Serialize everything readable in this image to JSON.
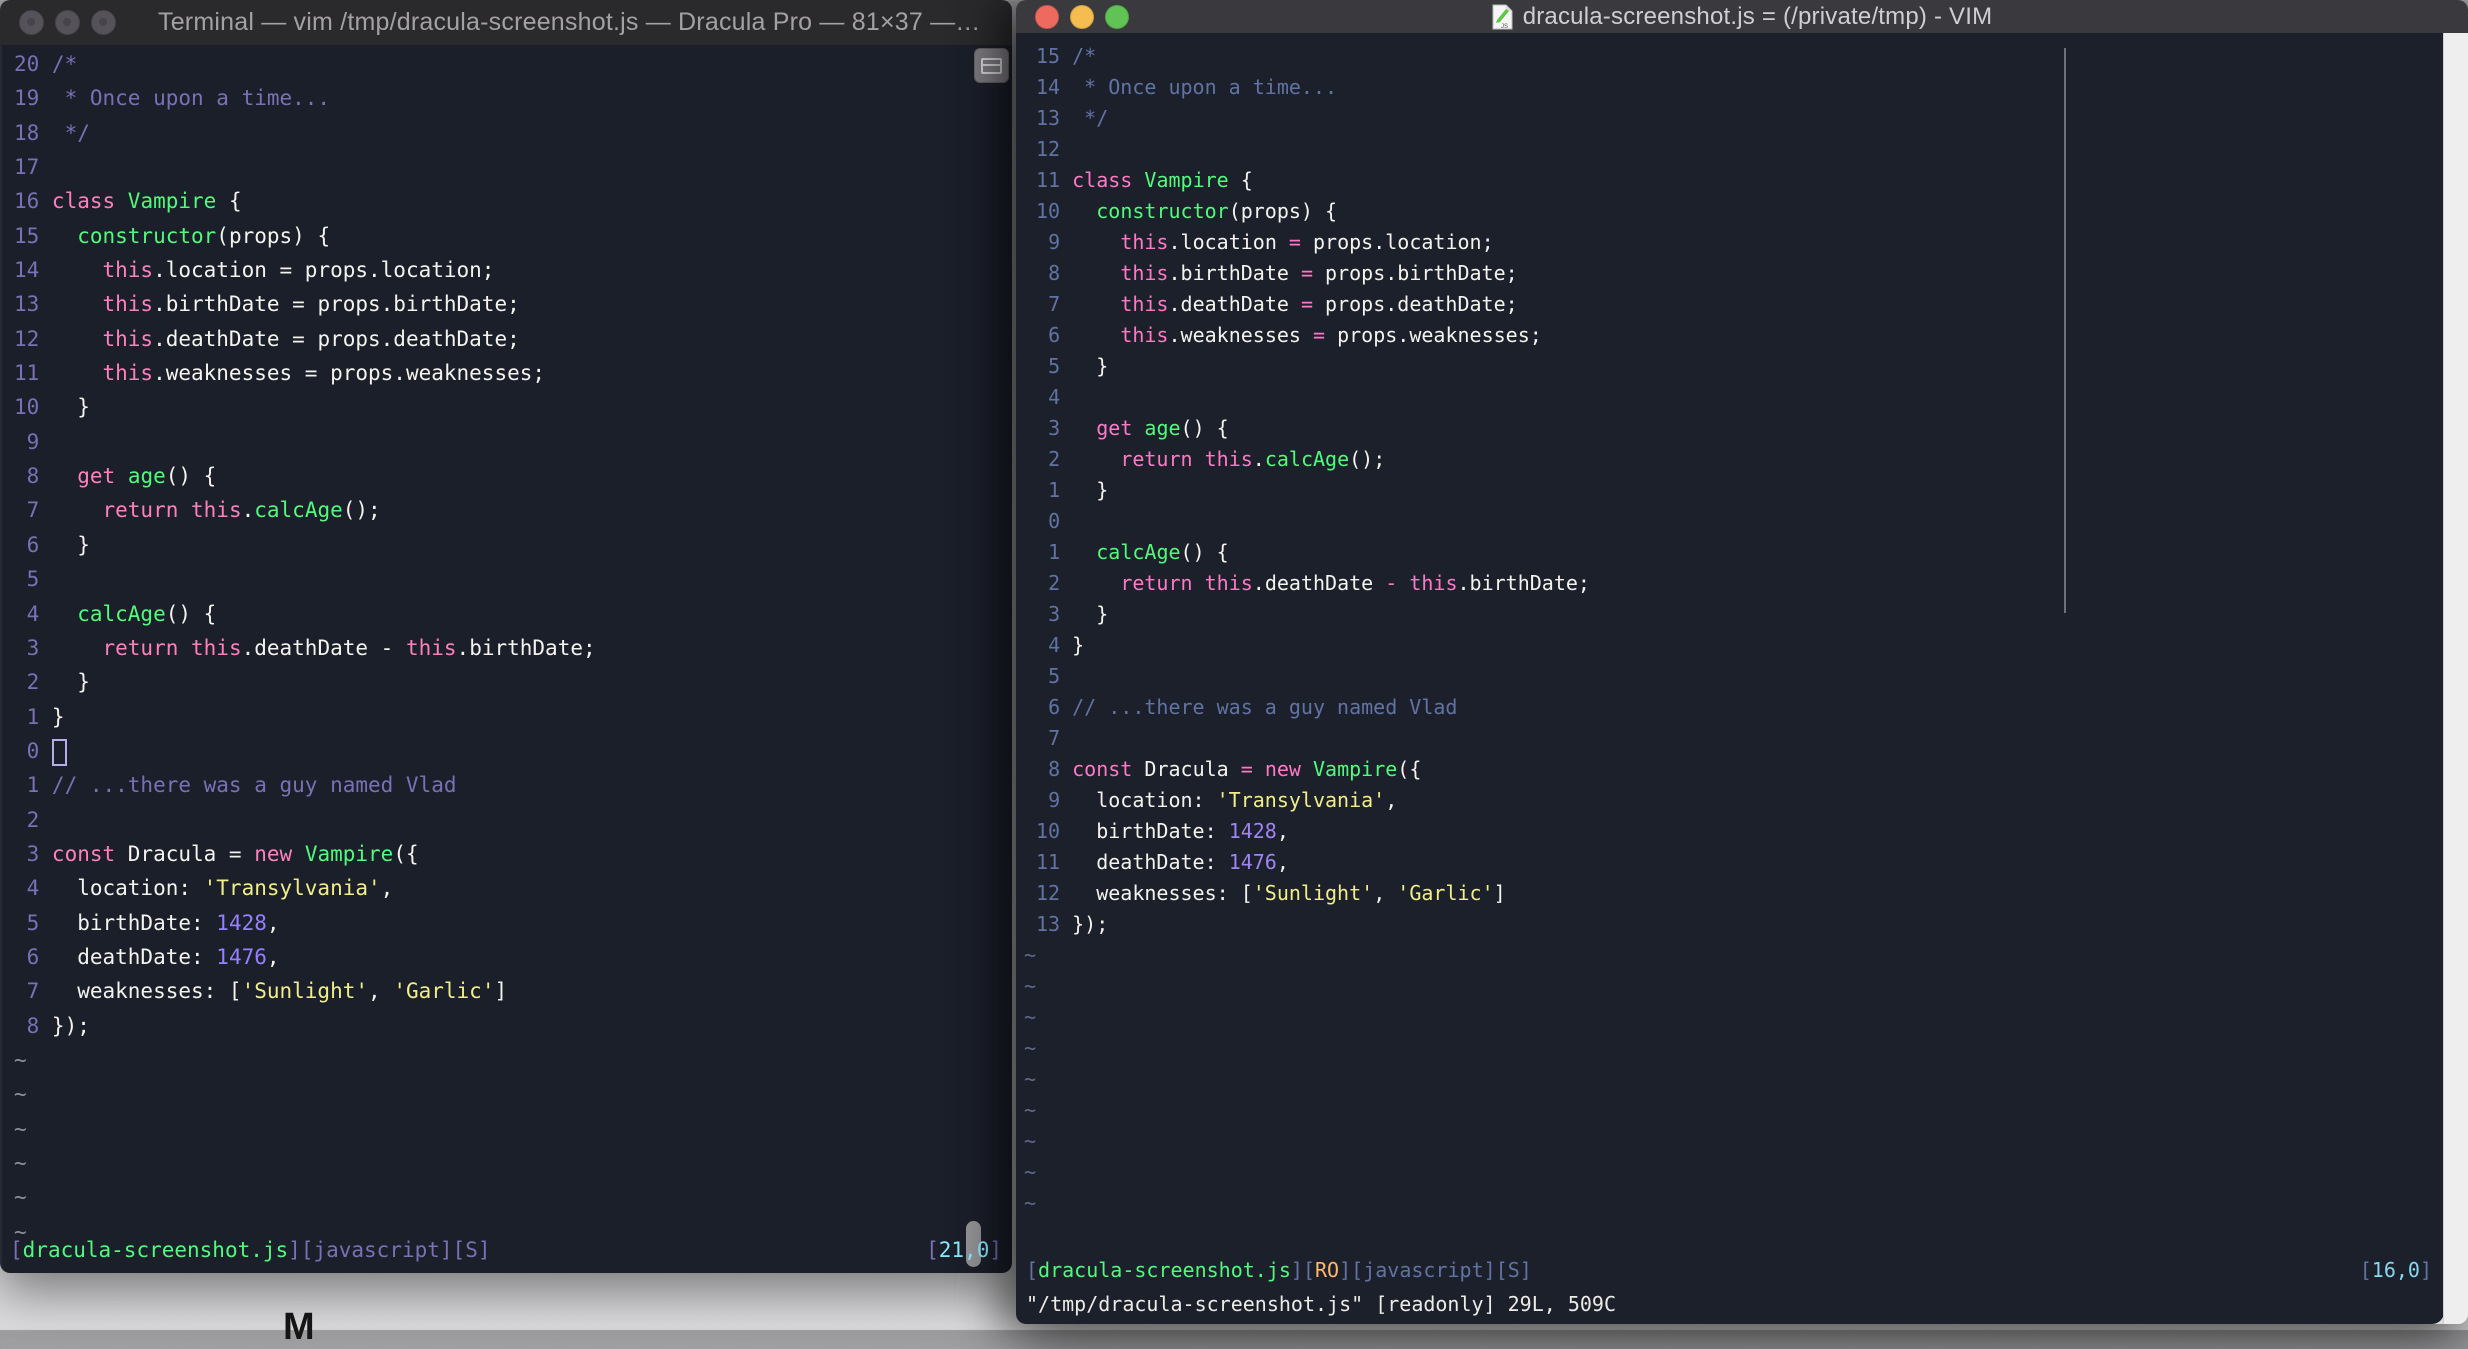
{
  "desktop": {
    "artifact_mark": "M"
  },
  "left_window": {
    "title": "Terminal — vim /tmp/dracula-screenshot.js — Dracula Pro — 81×37 —…",
    "palette": {
      "bg": "#1b1f2a",
      "titlebar": "#2a292b",
      "title_fg": "#a3a1a4",
      "ln": "#7a70b5",
      "com": "#7a70b5",
      "pink": "#ff80bf",
      "green": "#50fa7b",
      "num": "#9580ff",
      "str": "#f1ee8a",
      "cyan": "#8be9fd",
      "orange": "#ffb86c",
      "fg": "#f4f3ee",
      "tilde": "#8f8f99",
      "cursor": "#b5ace8"
    },
    "tilde_count": 6,
    "lines": [
      {
        "n": "20",
        "segs": [
          {
            "c": "com",
            "t": "/*"
          }
        ]
      },
      {
        "n": "19",
        "segs": [
          {
            "c": "com",
            "t": " * Once upon a time..."
          }
        ]
      },
      {
        "n": "18",
        "segs": [
          {
            "c": "com",
            "t": " */"
          }
        ]
      },
      {
        "n": "17",
        "segs": []
      },
      {
        "n": "16",
        "segs": [
          {
            "c": "pink",
            "t": "class"
          },
          {
            "c": "fg",
            "t": " "
          },
          {
            "c": "green",
            "t": "Vampire"
          },
          {
            "c": "fg",
            "t": " {"
          }
        ]
      },
      {
        "n": "15",
        "segs": [
          {
            "c": "fg",
            "t": "  "
          },
          {
            "c": "green",
            "t": "constructor"
          },
          {
            "c": "fg",
            "t": "(props) {"
          }
        ]
      },
      {
        "n": "14",
        "segs": [
          {
            "c": "fg",
            "t": "    "
          },
          {
            "c": "pink",
            "t": "this"
          },
          {
            "c": "fg",
            "t": ".location = props.location;"
          }
        ]
      },
      {
        "n": "13",
        "segs": [
          {
            "c": "fg",
            "t": "    "
          },
          {
            "c": "pink",
            "t": "this"
          },
          {
            "c": "fg",
            "t": ".birthDate = props.birthDate;"
          }
        ]
      },
      {
        "n": "12",
        "segs": [
          {
            "c": "fg",
            "t": "    "
          },
          {
            "c": "pink",
            "t": "this"
          },
          {
            "c": "fg",
            "t": ".deathDate = props.deathDate;"
          }
        ]
      },
      {
        "n": "11",
        "segs": [
          {
            "c": "fg",
            "t": "    "
          },
          {
            "c": "pink",
            "t": "this"
          },
          {
            "c": "fg",
            "t": ".weaknesses = props.weaknesses;"
          }
        ]
      },
      {
        "n": "10",
        "segs": [
          {
            "c": "fg",
            "t": "  }"
          }
        ]
      },
      {
        "n": "9",
        "segs": []
      },
      {
        "n": "8",
        "segs": [
          {
            "c": "fg",
            "t": "  "
          },
          {
            "c": "pink",
            "t": "get"
          },
          {
            "c": "fg",
            "t": " "
          },
          {
            "c": "green",
            "t": "age"
          },
          {
            "c": "fg",
            "t": "() {"
          }
        ]
      },
      {
        "n": "7",
        "segs": [
          {
            "c": "fg",
            "t": "    "
          },
          {
            "c": "pink",
            "t": "return"
          },
          {
            "c": "fg",
            "t": " "
          },
          {
            "c": "pink",
            "t": "this"
          },
          {
            "c": "fg",
            "t": "."
          },
          {
            "c": "green",
            "t": "calcAge"
          },
          {
            "c": "fg",
            "t": "();"
          }
        ]
      },
      {
        "n": "6",
        "segs": [
          {
            "c": "fg",
            "t": "  }"
          }
        ]
      },
      {
        "n": "5",
        "segs": []
      },
      {
        "n": "4",
        "segs": [
          {
            "c": "fg",
            "t": "  "
          },
          {
            "c": "green",
            "t": "calcAge"
          },
          {
            "c": "fg",
            "t": "() {"
          }
        ]
      },
      {
        "n": "3",
        "segs": [
          {
            "c": "fg",
            "t": "    "
          },
          {
            "c": "pink",
            "t": "return"
          },
          {
            "c": "fg",
            "t": " "
          },
          {
            "c": "pink",
            "t": "this"
          },
          {
            "c": "fg",
            "t": ".deathDate - "
          },
          {
            "c": "pink",
            "t": "this"
          },
          {
            "c": "fg",
            "t": ".birthDate;"
          }
        ]
      },
      {
        "n": "2",
        "segs": [
          {
            "c": "fg",
            "t": "  }"
          }
        ]
      },
      {
        "n": "1",
        "segs": [
          {
            "c": "fg",
            "t": "}"
          }
        ]
      },
      {
        "n": "0",
        "segs": [],
        "cursor": true
      },
      {
        "n": "1",
        "segs": [
          {
            "c": "com",
            "t": "// ...there was a guy named Vlad"
          }
        ]
      },
      {
        "n": "2",
        "segs": []
      },
      {
        "n": "3",
        "segs": [
          {
            "c": "pink",
            "t": "const"
          },
          {
            "c": "fg",
            "t": " Dracula = "
          },
          {
            "c": "pink",
            "t": "new"
          },
          {
            "c": "fg",
            "t": " "
          },
          {
            "c": "green",
            "t": "Vampire"
          },
          {
            "c": "fg",
            "t": "({"
          }
        ]
      },
      {
        "n": "4",
        "segs": [
          {
            "c": "fg",
            "t": "  location: "
          },
          {
            "c": "str",
            "t": "'Transylvania'"
          },
          {
            "c": "fg",
            "t": ","
          }
        ]
      },
      {
        "n": "5",
        "segs": [
          {
            "c": "fg",
            "t": "  birthDate: "
          },
          {
            "c": "num",
            "t": "1428"
          },
          {
            "c": "fg",
            "t": ","
          }
        ]
      },
      {
        "n": "6",
        "segs": [
          {
            "c": "fg",
            "t": "  deathDate: "
          },
          {
            "c": "num",
            "t": "1476"
          },
          {
            "c": "fg",
            "t": ","
          }
        ]
      },
      {
        "n": "7",
        "segs": [
          {
            "c": "fg",
            "t": "  weaknesses: ["
          },
          {
            "c": "str",
            "t": "'Sunlight'"
          },
          {
            "c": "fg",
            "t": ", "
          },
          {
            "c": "str",
            "t": "'Garlic'"
          },
          {
            "c": "fg",
            "t": "]"
          }
        ]
      },
      {
        "n": "8",
        "segs": [
          {
            "c": "fg",
            "t": "});"
          }
        ]
      }
    ],
    "status_left": [
      {
        "c": "ln",
        "t": "["
      },
      {
        "c": "green",
        "t": "dracula-screenshot.js"
      },
      {
        "c": "ln",
        "t": "]["
      },
      {
        "c": "ln",
        "t": "javascript"
      },
      {
        "c": "ln",
        "t": "]["
      },
      {
        "c": "ln",
        "t": "S"
      },
      {
        "c": "ln",
        "t": "]"
      }
    ],
    "status_right": [
      {
        "c": "ln",
        "t": "["
      },
      {
        "c": "cyan",
        "t": "21,0"
      },
      {
        "c": "ln",
        "t": "]"
      }
    ]
  },
  "right_window": {
    "title": "dracula-screenshot.js = (/private/tmp) - VIM",
    "palette": {
      "bg": "#1c202b",
      "titlebar": "#3a393d",
      "title_fg": "#cfced1",
      "ln": "#6173a2",
      "com": "#6173a2",
      "pink": "#ff79c6",
      "green": "#50fa7b",
      "num": "#9e85f2",
      "str": "#f1ee8a",
      "cyan": "#87d7f0",
      "orange": "#ffb86c",
      "fg": "#f4f3ee",
      "tilde": "#5f6b8c",
      "cursor": "#b5ace8"
    },
    "traffic_colors": {
      "close": "#ee6a5f",
      "minimize": "#f5bd4f",
      "zoom": "#61c354"
    },
    "tilde_count": 9,
    "lines": [
      {
        "n": "15",
        "segs": [
          {
            "c": "com",
            "t": "/*"
          }
        ]
      },
      {
        "n": "14",
        "segs": [
          {
            "c": "com",
            "t": " * Once upon a time..."
          }
        ]
      },
      {
        "n": "13",
        "segs": [
          {
            "c": "com",
            "t": " */"
          }
        ]
      },
      {
        "n": "12",
        "segs": []
      },
      {
        "n": "11",
        "segs": [
          {
            "c": "pink",
            "t": "class"
          },
          {
            "c": "fg",
            "t": " "
          },
          {
            "c": "green",
            "t": "Vampire"
          },
          {
            "c": "fg",
            "t": " {"
          }
        ]
      },
      {
        "n": "10",
        "segs": [
          {
            "c": "fg",
            "t": "  "
          },
          {
            "c": "green",
            "t": "constructor"
          },
          {
            "c": "fg",
            "t": "(props) {"
          }
        ]
      },
      {
        "n": "9",
        "segs": [
          {
            "c": "fg",
            "t": "    "
          },
          {
            "c": "pink",
            "t": "this"
          },
          {
            "c": "fg",
            "t": ".location "
          },
          {
            "c": "pink",
            "t": "="
          },
          {
            "c": "fg",
            "t": " props.location;"
          }
        ]
      },
      {
        "n": "8",
        "segs": [
          {
            "c": "fg",
            "t": "    "
          },
          {
            "c": "pink",
            "t": "this"
          },
          {
            "c": "fg",
            "t": ".birthDate "
          },
          {
            "c": "pink",
            "t": "="
          },
          {
            "c": "fg",
            "t": " props.birthDate;"
          }
        ]
      },
      {
        "n": "7",
        "segs": [
          {
            "c": "fg",
            "t": "    "
          },
          {
            "c": "pink",
            "t": "this"
          },
          {
            "c": "fg",
            "t": ".deathDate "
          },
          {
            "c": "pink",
            "t": "="
          },
          {
            "c": "fg",
            "t": " props.deathDate;"
          }
        ]
      },
      {
        "n": "6",
        "segs": [
          {
            "c": "fg",
            "t": "    "
          },
          {
            "c": "pink",
            "t": "this"
          },
          {
            "c": "fg",
            "t": ".weaknesses "
          },
          {
            "c": "pink",
            "t": "="
          },
          {
            "c": "fg",
            "t": " props.weaknesses;"
          }
        ]
      },
      {
        "n": "5",
        "segs": [
          {
            "c": "fg",
            "t": "  }"
          }
        ]
      },
      {
        "n": "4",
        "segs": []
      },
      {
        "n": "3",
        "segs": [
          {
            "c": "fg",
            "t": "  "
          },
          {
            "c": "pink",
            "t": "get"
          },
          {
            "c": "fg",
            "t": " "
          },
          {
            "c": "green",
            "t": "age"
          },
          {
            "c": "fg",
            "t": "() {"
          }
        ]
      },
      {
        "n": "2",
        "segs": [
          {
            "c": "fg",
            "t": "    "
          },
          {
            "c": "pink",
            "t": "return"
          },
          {
            "c": "fg",
            "t": " "
          },
          {
            "c": "pink",
            "t": "this"
          },
          {
            "c": "fg",
            "t": "."
          },
          {
            "c": "green",
            "t": "calcAge"
          },
          {
            "c": "fg",
            "t": "();"
          }
        ]
      },
      {
        "n": "1",
        "segs": [
          {
            "c": "fg",
            "t": "  }"
          }
        ]
      },
      {
        "n": "0",
        "segs": []
      },
      {
        "n": "1",
        "segs": [
          {
            "c": "fg",
            "t": "  "
          },
          {
            "c": "green",
            "t": "calcAge"
          },
          {
            "c": "fg",
            "t": "() {"
          }
        ]
      },
      {
        "n": "2",
        "segs": [
          {
            "c": "fg",
            "t": "    "
          },
          {
            "c": "pink",
            "t": "return"
          },
          {
            "c": "fg",
            "t": " "
          },
          {
            "c": "pink",
            "t": "this"
          },
          {
            "c": "fg",
            "t": ".deathDate "
          },
          {
            "c": "pink",
            "t": "-"
          },
          {
            "c": "fg",
            "t": " "
          },
          {
            "c": "pink",
            "t": "this"
          },
          {
            "c": "fg",
            "t": ".birthDate;"
          }
        ]
      },
      {
        "n": "3",
        "segs": [
          {
            "c": "fg",
            "t": "  }"
          }
        ]
      },
      {
        "n": "4",
        "segs": [
          {
            "c": "fg",
            "t": "}"
          }
        ]
      },
      {
        "n": "5",
        "segs": []
      },
      {
        "n": "6",
        "segs": [
          {
            "c": "com",
            "t": "// ...there was a guy named Vlad"
          }
        ]
      },
      {
        "n": "7",
        "segs": []
      },
      {
        "n": "8",
        "segs": [
          {
            "c": "pink",
            "t": "const"
          },
          {
            "c": "fg",
            "t": " Dracula "
          },
          {
            "c": "pink",
            "t": "="
          },
          {
            "c": "fg",
            "t": " "
          },
          {
            "c": "pink",
            "t": "new"
          },
          {
            "c": "fg",
            "t": " "
          },
          {
            "c": "green",
            "t": "Vampire"
          },
          {
            "c": "fg",
            "t": "({"
          }
        ]
      },
      {
        "n": "9",
        "segs": [
          {
            "c": "fg",
            "t": "  location: "
          },
          {
            "c": "str",
            "t": "'Transylvania'"
          },
          {
            "c": "fg",
            "t": ","
          }
        ]
      },
      {
        "n": "10",
        "segs": [
          {
            "c": "fg",
            "t": "  birthDate: "
          },
          {
            "c": "num",
            "t": "1428"
          },
          {
            "c": "fg",
            "t": ","
          }
        ]
      },
      {
        "n": "11",
        "segs": [
          {
            "c": "fg",
            "t": "  deathDate: "
          },
          {
            "c": "num",
            "t": "1476"
          },
          {
            "c": "fg",
            "t": ","
          }
        ]
      },
      {
        "n": "12",
        "segs": [
          {
            "c": "fg",
            "t": "  weaknesses: ["
          },
          {
            "c": "str",
            "t": "'Sunlight'"
          },
          {
            "c": "fg",
            "t": ", "
          },
          {
            "c": "str",
            "t": "'Garlic'"
          },
          {
            "c": "fg",
            "t": "]"
          }
        ]
      },
      {
        "n": "13",
        "segs": [
          {
            "c": "fg",
            "t": "});"
          }
        ]
      }
    ],
    "status_left": [
      {
        "c": "ln",
        "t": "["
      },
      {
        "c": "green",
        "t": "dracula-screenshot.js"
      },
      {
        "c": "ln",
        "t": "]["
      },
      {
        "c": "orange",
        "t": "RO"
      },
      {
        "c": "ln",
        "t": "]["
      },
      {
        "c": "ln",
        "t": "javascript"
      },
      {
        "c": "ln",
        "t": "]["
      },
      {
        "c": "ln",
        "t": "S"
      },
      {
        "c": "ln",
        "t": "]"
      }
    ],
    "status_right": [
      {
        "c": "ln",
        "t": "["
      },
      {
        "c": "cyan",
        "t": "16,0"
      },
      {
        "c": "ln",
        "t": "]"
      }
    ],
    "message": "\"/tmp/dracula-screenshot.js\" [readonly] 29L, 509C"
  }
}
